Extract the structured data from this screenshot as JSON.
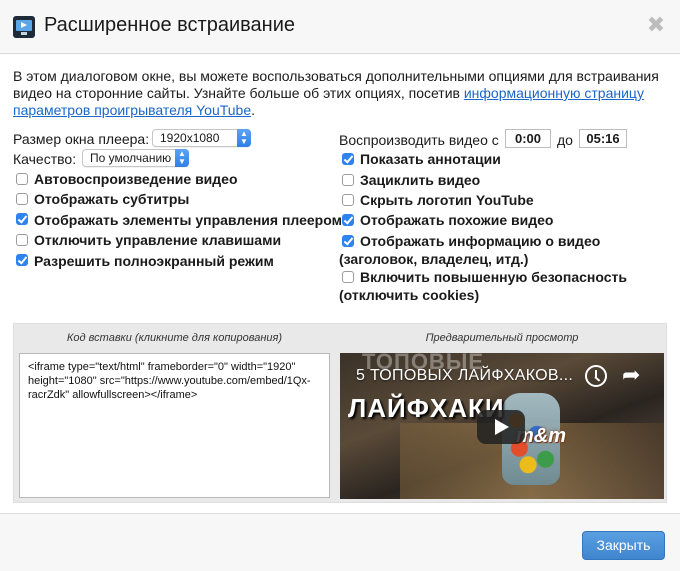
{
  "dialog": {
    "title": "Расширенное встраивание",
    "intro_text": "В этом диалоговом окне, вы можете воспользоваться дополнительными опциями для встраивания видео на сторонние сайты. Узнайте больше об этих опциях, посетив ",
    "intro_link": "информационную страницу параметров проигрывателя YouTube",
    "intro_end": "."
  },
  "settings": {
    "player_size_label": "Размер окна плеера:",
    "player_size_value": "1920x1080",
    "quality_label": "Качество:",
    "quality_value": "По умолчанию",
    "play_from_label": "Воспроизводить видео с",
    "start_time": "0:00",
    "to_label": "до",
    "end_time": "05:16"
  },
  "left_options": [
    {
      "label": "Автовоспроизведение видео",
      "checked": false
    },
    {
      "label": "Отображать субтитры",
      "checked": false
    },
    {
      "label": "Отображать элементы управления плеером",
      "checked": true
    },
    {
      "label": "Отключить управление клавишами",
      "checked": false
    },
    {
      "label": "Разрешить полноэкранный режим",
      "checked": true
    }
  ],
  "right_options": [
    {
      "label": "Показать аннотации",
      "checked": true
    },
    {
      "label": "Зациклить видео",
      "checked": false
    },
    {
      "label": "Скрыть логотип YouTube",
      "checked": false
    },
    {
      "label": "Отображать похожие видео",
      "checked": true
    },
    {
      "label": "Отображать информацию о видео (заголовок, владелец, итд.)",
      "checked": true
    },
    {
      "label": "Включить повышенную безопасность (отключить cookies)",
      "checked": false
    }
  ],
  "embed": {
    "code_caption": "Код вставки (кликните для копирования)",
    "code": "<iframe type=\"text/html\" frameborder=\"0\" width=\"1920\" height=\"1080\" src=\"https://www.youtube.com/embed/1Qx-racrZdk\" allowfullscreen></iframe>",
    "preview_caption": "Предварительный просмотр",
    "video_title": "5 ТОПОВЫХ ЛАЙФХАКОВ...",
    "thumb_word_top": "ТОПОВЫЕ",
    "thumb_word": "ЛАЙФХАКИ",
    "thumb_brand": "m&m"
  },
  "footer": {
    "close_label": "Закрыть"
  }
}
